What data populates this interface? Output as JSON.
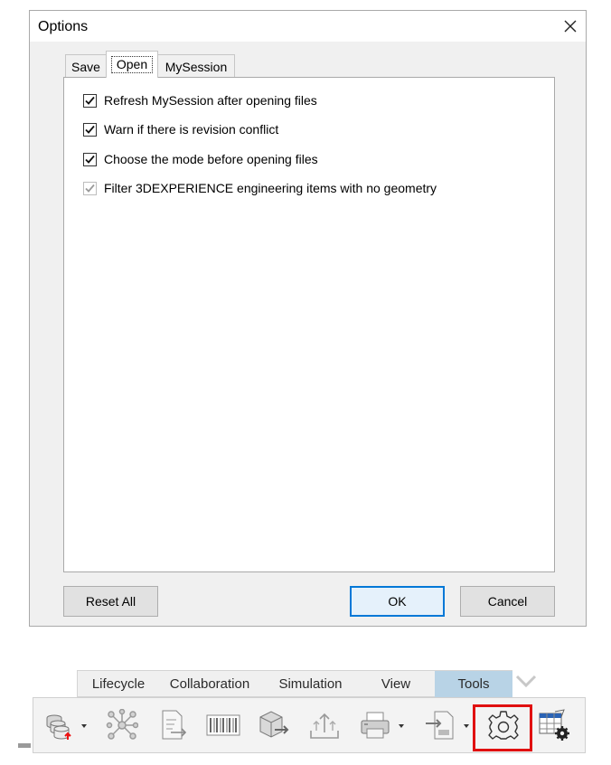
{
  "dialog": {
    "title": "Options",
    "tabs": [
      {
        "label": "Save"
      },
      {
        "label": "Open",
        "active": true
      },
      {
        "label": "MySession"
      }
    ],
    "options": [
      {
        "label": "Refresh MySession after opening files",
        "checked": true,
        "enabled": true,
        "highlighted": true
      },
      {
        "label": "Warn if there is revision conflict",
        "checked": true,
        "enabled": true
      },
      {
        "label": "Choose the mode before opening files",
        "checked": true,
        "enabled": true
      },
      {
        "label": "Filter 3DEXPERIENCE engineering items with no geometry",
        "checked": true,
        "enabled": false
      }
    ],
    "buttons": {
      "reset": "Reset All",
      "ok": "OK",
      "cancel": "Cancel"
    }
  },
  "ribbon": {
    "tabs": [
      {
        "label": "Lifecycle"
      },
      {
        "label": "Collaboration"
      },
      {
        "label": "Simulation"
      },
      {
        "label": "View"
      },
      {
        "label": "Tools",
        "active": true
      }
    ],
    "tools": [
      {
        "icon": "database-update-icon",
        "has_dropdown": true
      },
      {
        "icon": "network-graph-icon"
      },
      {
        "icon": "document-compare-icon"
      },
      {
        "icon": "barcode-icon"
      },
      {
        "icon": "package-export-icon"
      },
      {
        "icon": "upload-tray-icon"
      },
      {
        "icon": "printer-icon",
        "has_dropdown": true
      },
      {
        "icon": "file-import-icon",
        "has_dropdown": true
      },
      {
        "icon": "gear-icon",
        "highlighted": true
      },
      {
        "icon": "table-settings-icon"
      }
    ]
  },
  "colors": {
    "highlight": "#e01010",
    "active_ribbon_tab": "#b8d3e6",
    "default_button_border": "#0078d7"
  }
}
